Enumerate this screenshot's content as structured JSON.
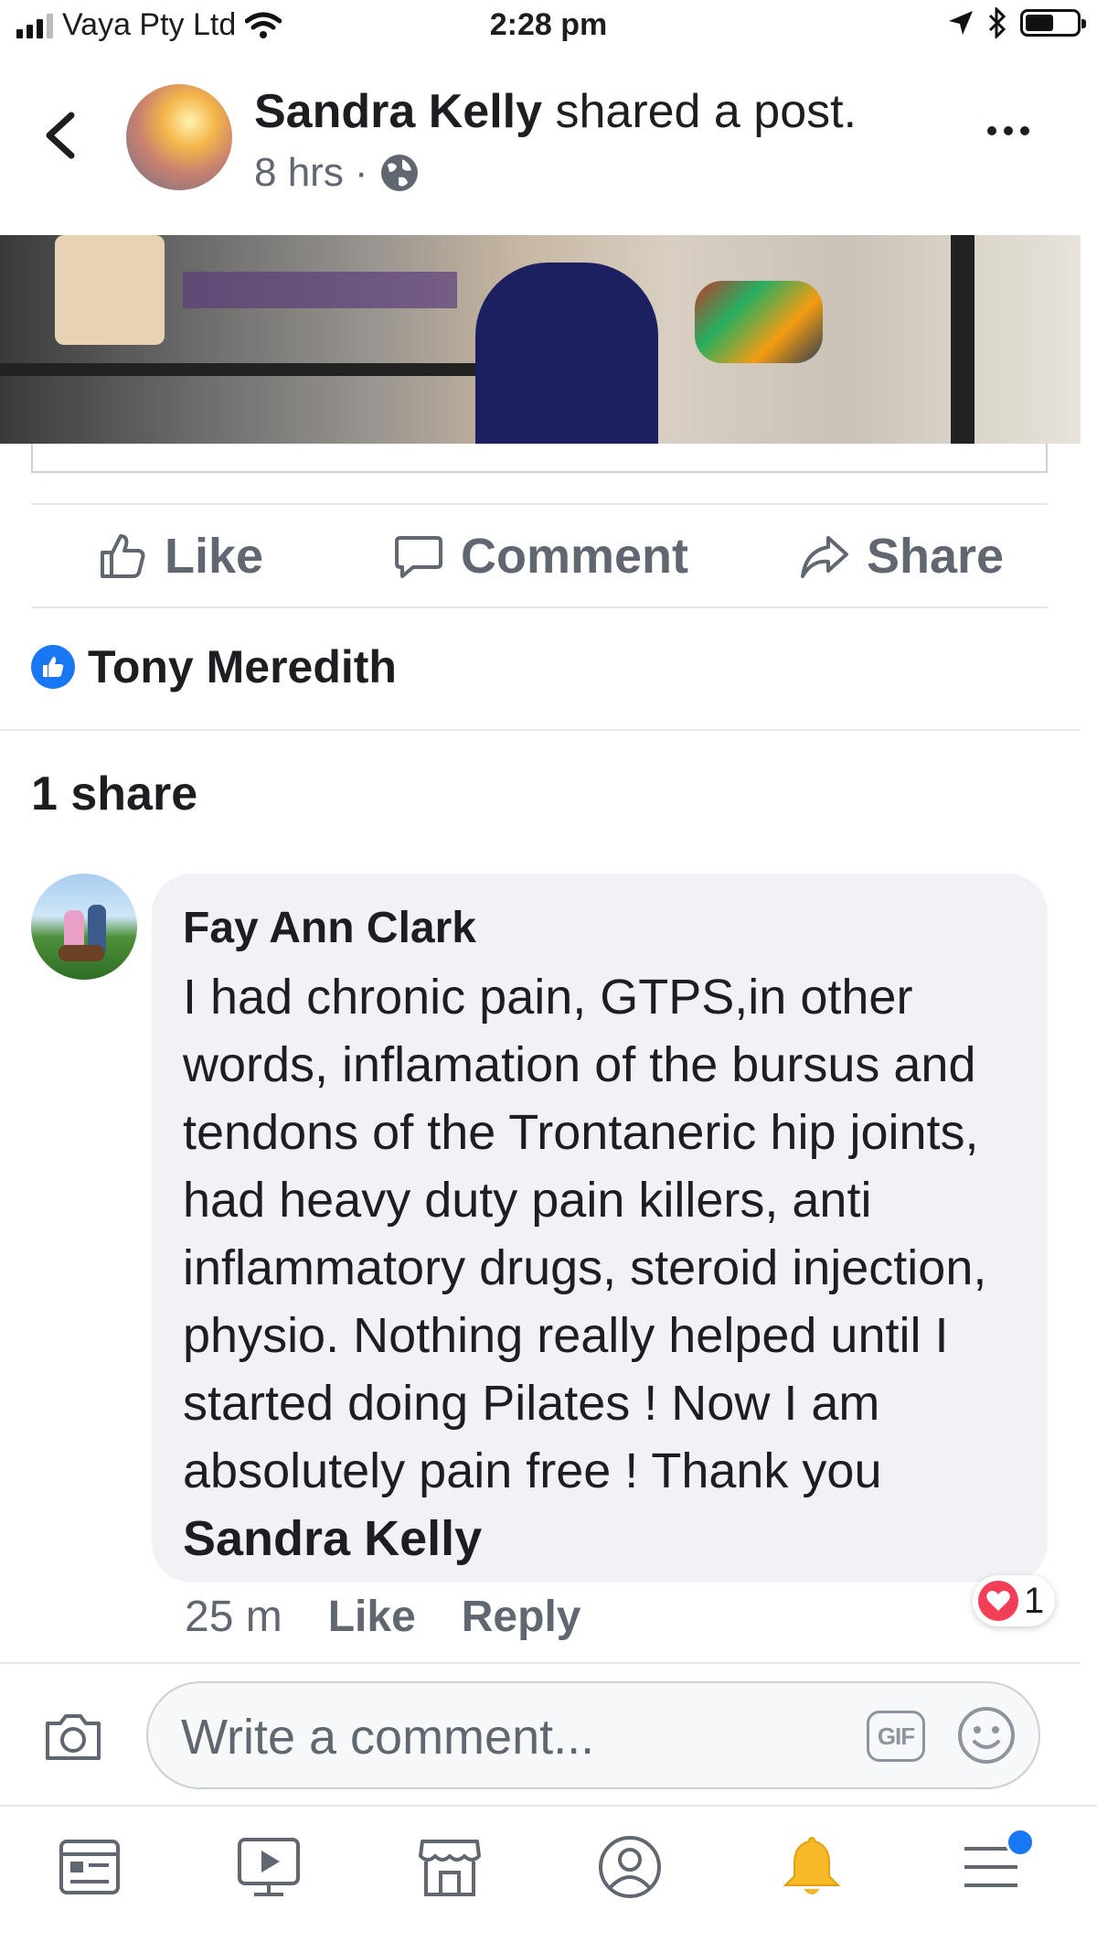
{
  "status_bar": {
    "carrier": "Vaya Pty Ltd",
    "time": "2:28 pm"
  },
  "post_header": {
    "author": "Sandra Kelly",
    "action_text": "shared a post.",
    "time_ago": "8 hrs",
    "separator": "·",
    "privacy_icon": "globe-icon"
  },
  "actions": {
    "like": "Like",
    "comment": "Comment",
    "share": "Share"
  },
  "likes": {
    "name": "Tony Meredith"
  },
  "shares": {
    "label": "1 share"
  },
  "comment": {
    "author": "Fay Ann Clark",
    "text": "I had chronic pain, GTPS,in other words, inflamation of the bursus and tendons of the Trontaneric hip joints, had heavy duty pain killers, anti inflammatory drugs, steroid injection, physio. Nothing really helped until I started doing Pilates !  Now I am absolutely pain free ! Thank you",
    "mention": "Sandra Kelly",
    "time": "25 m",
    "like_label": "Like",
    "reply_label": "Reply",
    "reaction_count": "1"
  },
  "composer": {
    "placeholder": "Write a comment...",
    "gif_label": "GIF"
  },
  "colors": {
    "accent": "#1877f2",
    "secondary_text": "#606770",
    "bubble": "#f0f2f5",
    "love": "#f33e58",
    "bell": "#f7b928"
  },
  "bottom_nav": {
    "items": [
      "news-feed-icon",
      "watch-icon",
      "marketplace-icon",
      "profile-icon",
      "notifications-icon",
      "menu-icon"
    ]
  }
}
